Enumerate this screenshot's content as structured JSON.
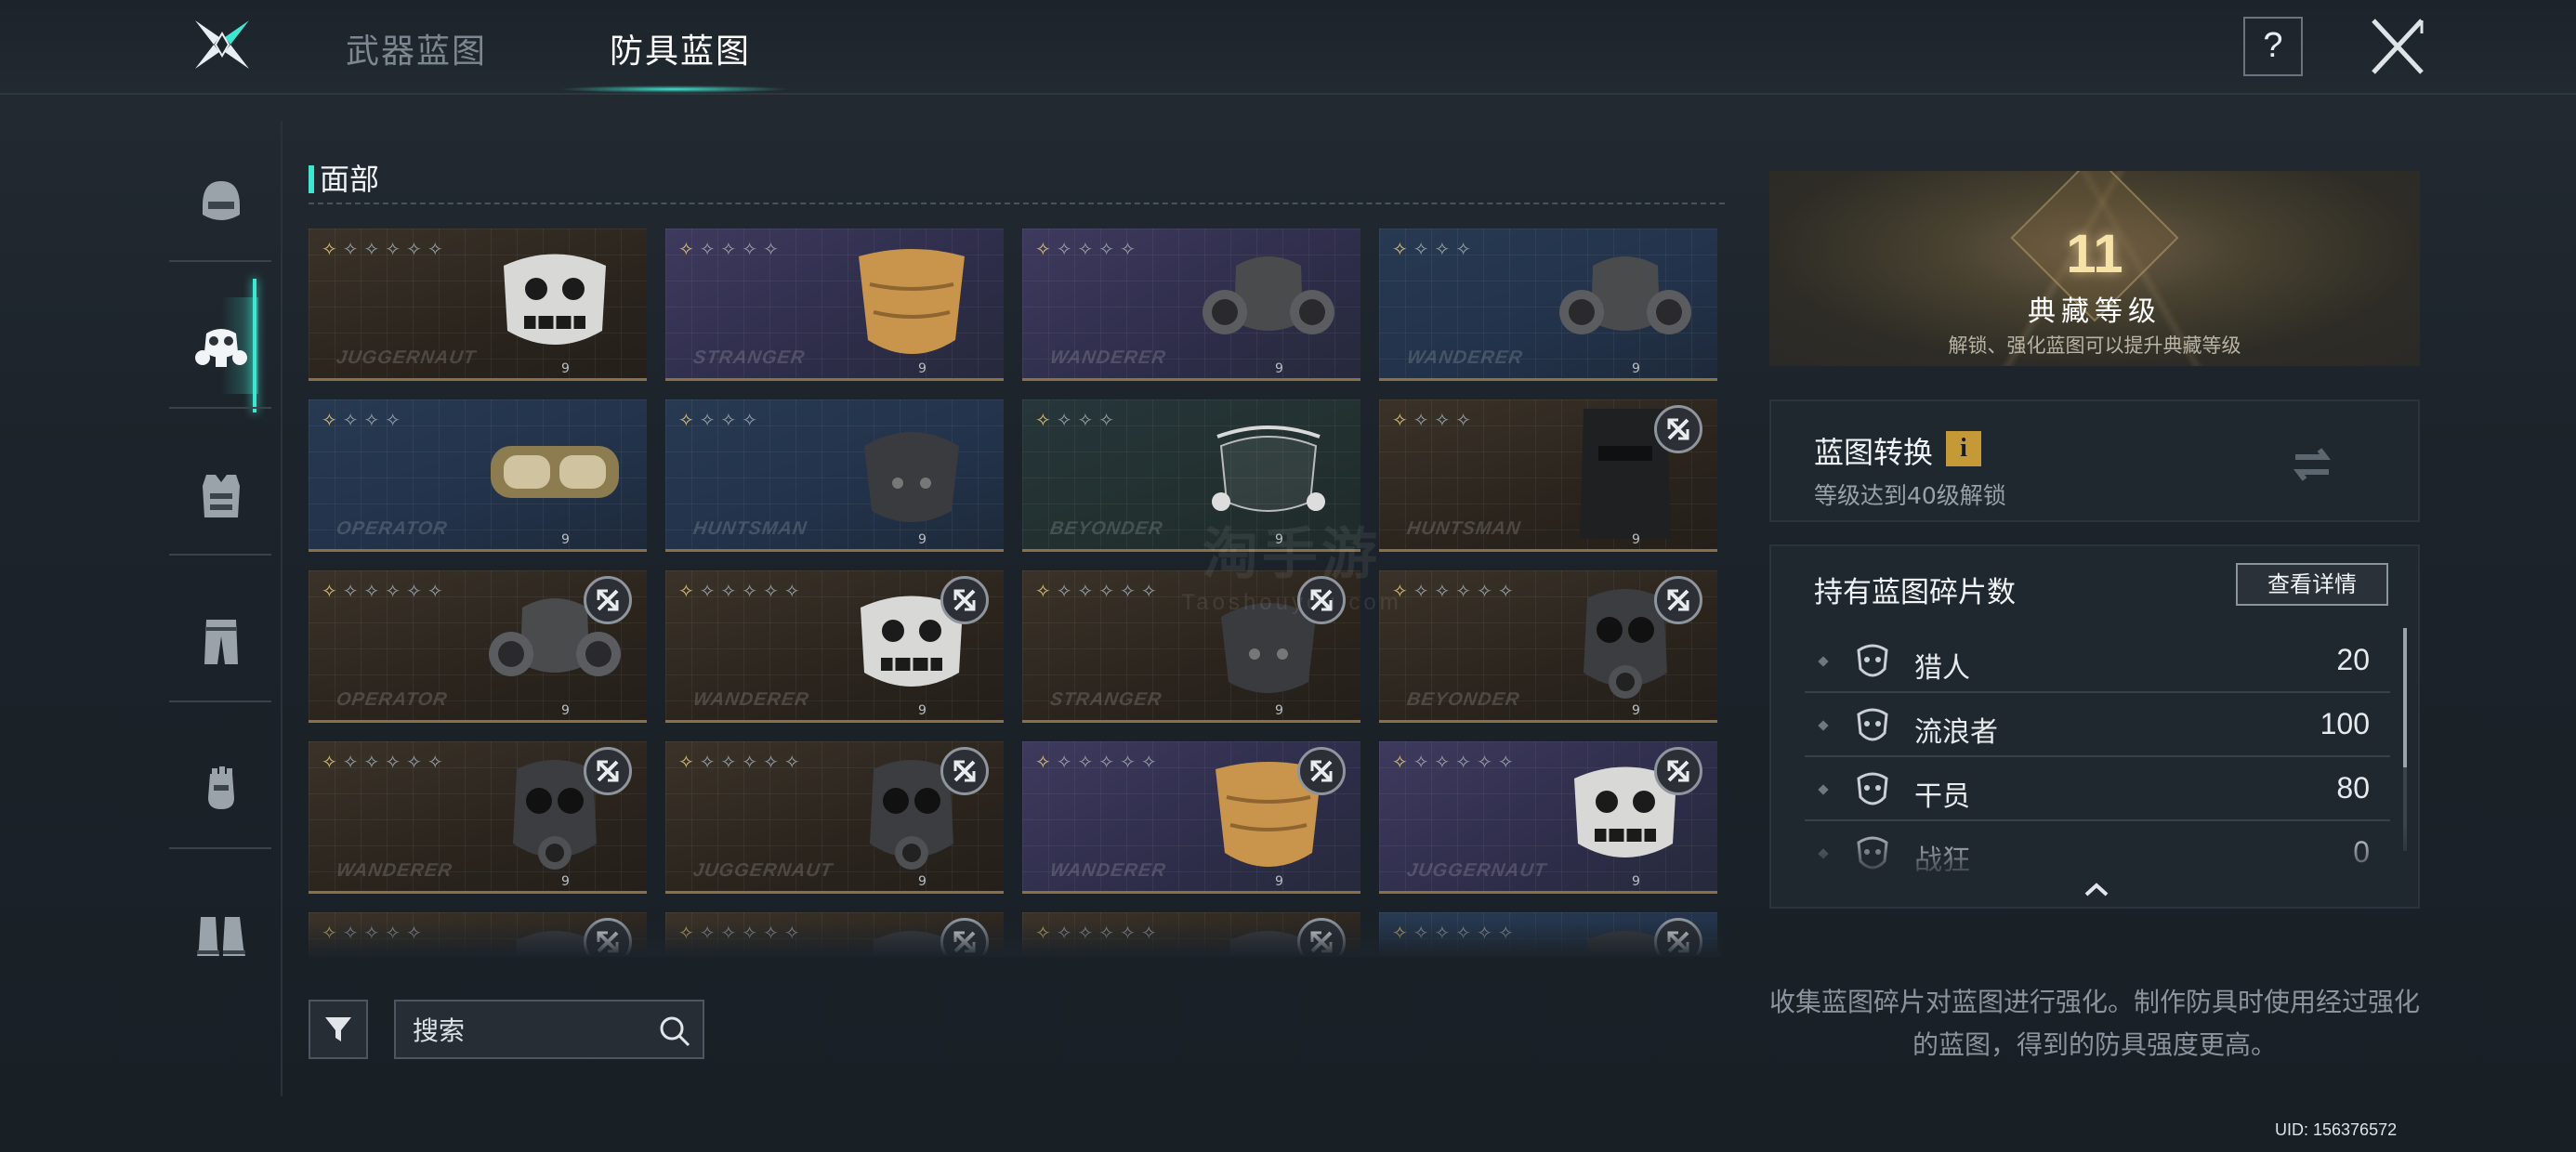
{
  "tabs": [
    {
      "label": "武器蓝图",
      "active": false
    },
    {
      "label": "防具蓝图",
      "active": true
    }
  ],
  "header": {
    "help_label": "?"
  },
  "sidebar": {
    "items": [
      {
        "icon": "helmet-icon",
        "active": false
      },
      {
        "icon": "gas-mask-icon",
        "active": true
      },
      {
        "icon": "vest-icon",
        "active": false
      },
      {
        "icon": "pants-icon",
        "active": false
      },
      {
        "icon": "glove-icon",
        "active": false
      },
      {
        "icon": "boots-icon",
        "active": false
      }
    ]
  },
  "section": {
    "title": "面部"
  },
  "cards": [
    {
      "brand": "JUGGERNAUT",
      "stars": 6,
      "gold_stars": 1,
      "level": "9",
      "theme": "bronze",
      "locked": false,
      "mask": "skull-mask-icon"
    },
    {
      "brand": "STRANGER",
      "stars": 5,
      "gold_stars": 1,
      "level": "9",
      "theme": "purple",
      "locked": false,
      "mask": "cloth-mask-icon"
    },
    {
      "brand": "WANDERER",
      "stars": 5,
      "gold_stars": 1,
      "level": "9",
      "theme": "purple",
      "locked": false,
      "mask": "respirator-icon"
    },
    {
      "brand": "WANDERER",
      "stars": 4,
      "gold_stars": 1,
      "level": "9",
      "theme": "blue",
      "locked": false,
      "mask": "respirator-icon"
    },
    {
      "brand": "OPERATOR",
      "stars": 4,
      "gold_stars": 1,
      "level": "9",
      "theme": "blue",
      "locked": false,
      "mask": "goggles-icon"
    },
    {
      "brand": "HUNTSMAN",
      "stars": 4,
      "gold_stars": 1,
      "level": "9",
      "theme": "blue",
      "locked": false,
      "mask": "half-mask-icon"
    },
    {
      "brand": "BEYONDER",
      "stars": 4,
      "gold_stars": 1,
      "level": "9",
      "theme": "green",
      "locked": false,
      "mask": "face-shield-icon"
    },
    {
      "brand": "HUNTSMAN",
      "stars": 4,
      "gold_stars": 1,
      "level": "9",
      "theme": "bronze",
      "locked": true,
      "mask": "balaclava-icon"
    },
    {
      "brand": "OPERATOR",
      "stars": 6,
      "gold_stars": 1,
      "level": "9",
      "theme": "bronze",
      "locked": true,
      "mask": "respirator-icon"
    },
    {
      "brand": "WANDERER",
      "stars": 6,
      "gold_stars": 1,
      "level": "9",
      "theme": "bronze",
      "locked": true,
      "mask": "skull-mask-icon"
    },
    {
      "brand": "STRANGER",
      "stars": 6,
      "gold_stars": 1,
      "level": "9",
      "theme": "bronze",
      "locked": true,
      "mask": "half-mask-icon"
    },
    {
      "brand": "BEYONDER",
      "stars": 6,
      "gold_stars": 1,
      "level": "9",
      "theme": "bronze",
      "locked": true,
      "mask": "gas-mask-icon"
    },
    {
      "brand": "WANDERER",
      "stars": 6,
      "gold_stars": 1,
      "level": "9",
      "theme": "bronze",
      "locked": true,
      "mask": "gas-mask-icon"
    },
    {
      "brand": "JUGGERNAUT",
      "stars": 6,
      "gold_stars": 1,
      "level": "9",
      "theme": "bronze",
      "locked": true,
      "mask": "gas-mask-icon"
    },
    {
      "brand": "WANDERER",
      "stars": 6,
      "gold_stars": 1,
      "level": "9",
      "theme": "purple",
      "locked": true,
      "mask": "cloth-mask-icon"
    },
    {
      "brand": "JUGGERNAUT",
      "stars": 6,
      "gold_stars": 1,
      "level": "9",
      "theme": "purple",
      "locked": true,
      "mask": "skull-mask-icon"
    },
    {
      "brand": "",
      "stars": 5,
      "gold_stars": 1,
      "level": "",
      "theme": "bronze",
      "locked": true,
      "mask": "gas-mask-icon"
    },
    {
      "brand": "",
      "stars": 6,
      "gold_stars": 1,
      "level": "",
      "theme": "bronze",
      "locked": true,
      "mask": "gas-mask-icon"
    },
    {
      "brand": "",
      "stars": 6,
      "gold_stars": 1,
      "level": "",
      "theme": "bronze",
      "locked": true,
      "mask": "gas-mask-icon"
    },
    {
      "brand": "",
      "stars": 6,
      "gold_stars": 1,
      "level": "",
      "theme": "blue",
      "locked": true,
      "mask": "gas-mask-icon"
    }
  ],
  "search": {
    "placeholder": "搜索"
  },
  "collection": {
    "level": "11",
    "title": "典藏等级",
    "subtitle": "解锁、强化蓝图可以提升典藏等级"
  },
  "convert": {
    "title": "蓝图转换",
    "info": "i",
    "subtitle": "等级达到40级解锁"
  },
  "fragments": {
    "title": "持有蓝图碎片数",
    "details_label": "查看详情",
    "items": [
      {
        "name": "猎人",
        "count": "20",
        "icon": "hunter-emblem-icon"
      },
      {
        "name": "流浪者",
        "count": "100",
        "icon": "wanderer-emblem-icon"
      },
      {
        "name": "干员",
        "count": "80",
        "icon": "operator-emblem-icon"
      },
      {
        "name": "战狂",
        "count": "0",
        "icon": "juggernaut-emblem-icon"
      }
    ]
  },
  "hint": "收集蓝图碎片对蓝图进行强化。制作防具时使用经过强化的蓝图，得到的防具强度更高。",
  "uid": "UID: 156376572",
  "watermark": {
    "cn": "淘手游",
    "en": "Taoshouyou.com"
  },
  "colors": {
    "accent": "#40e6cf",
    "gold": "#e2c26a",
    "collection_gold": "#f7e2a8"
  }
}
